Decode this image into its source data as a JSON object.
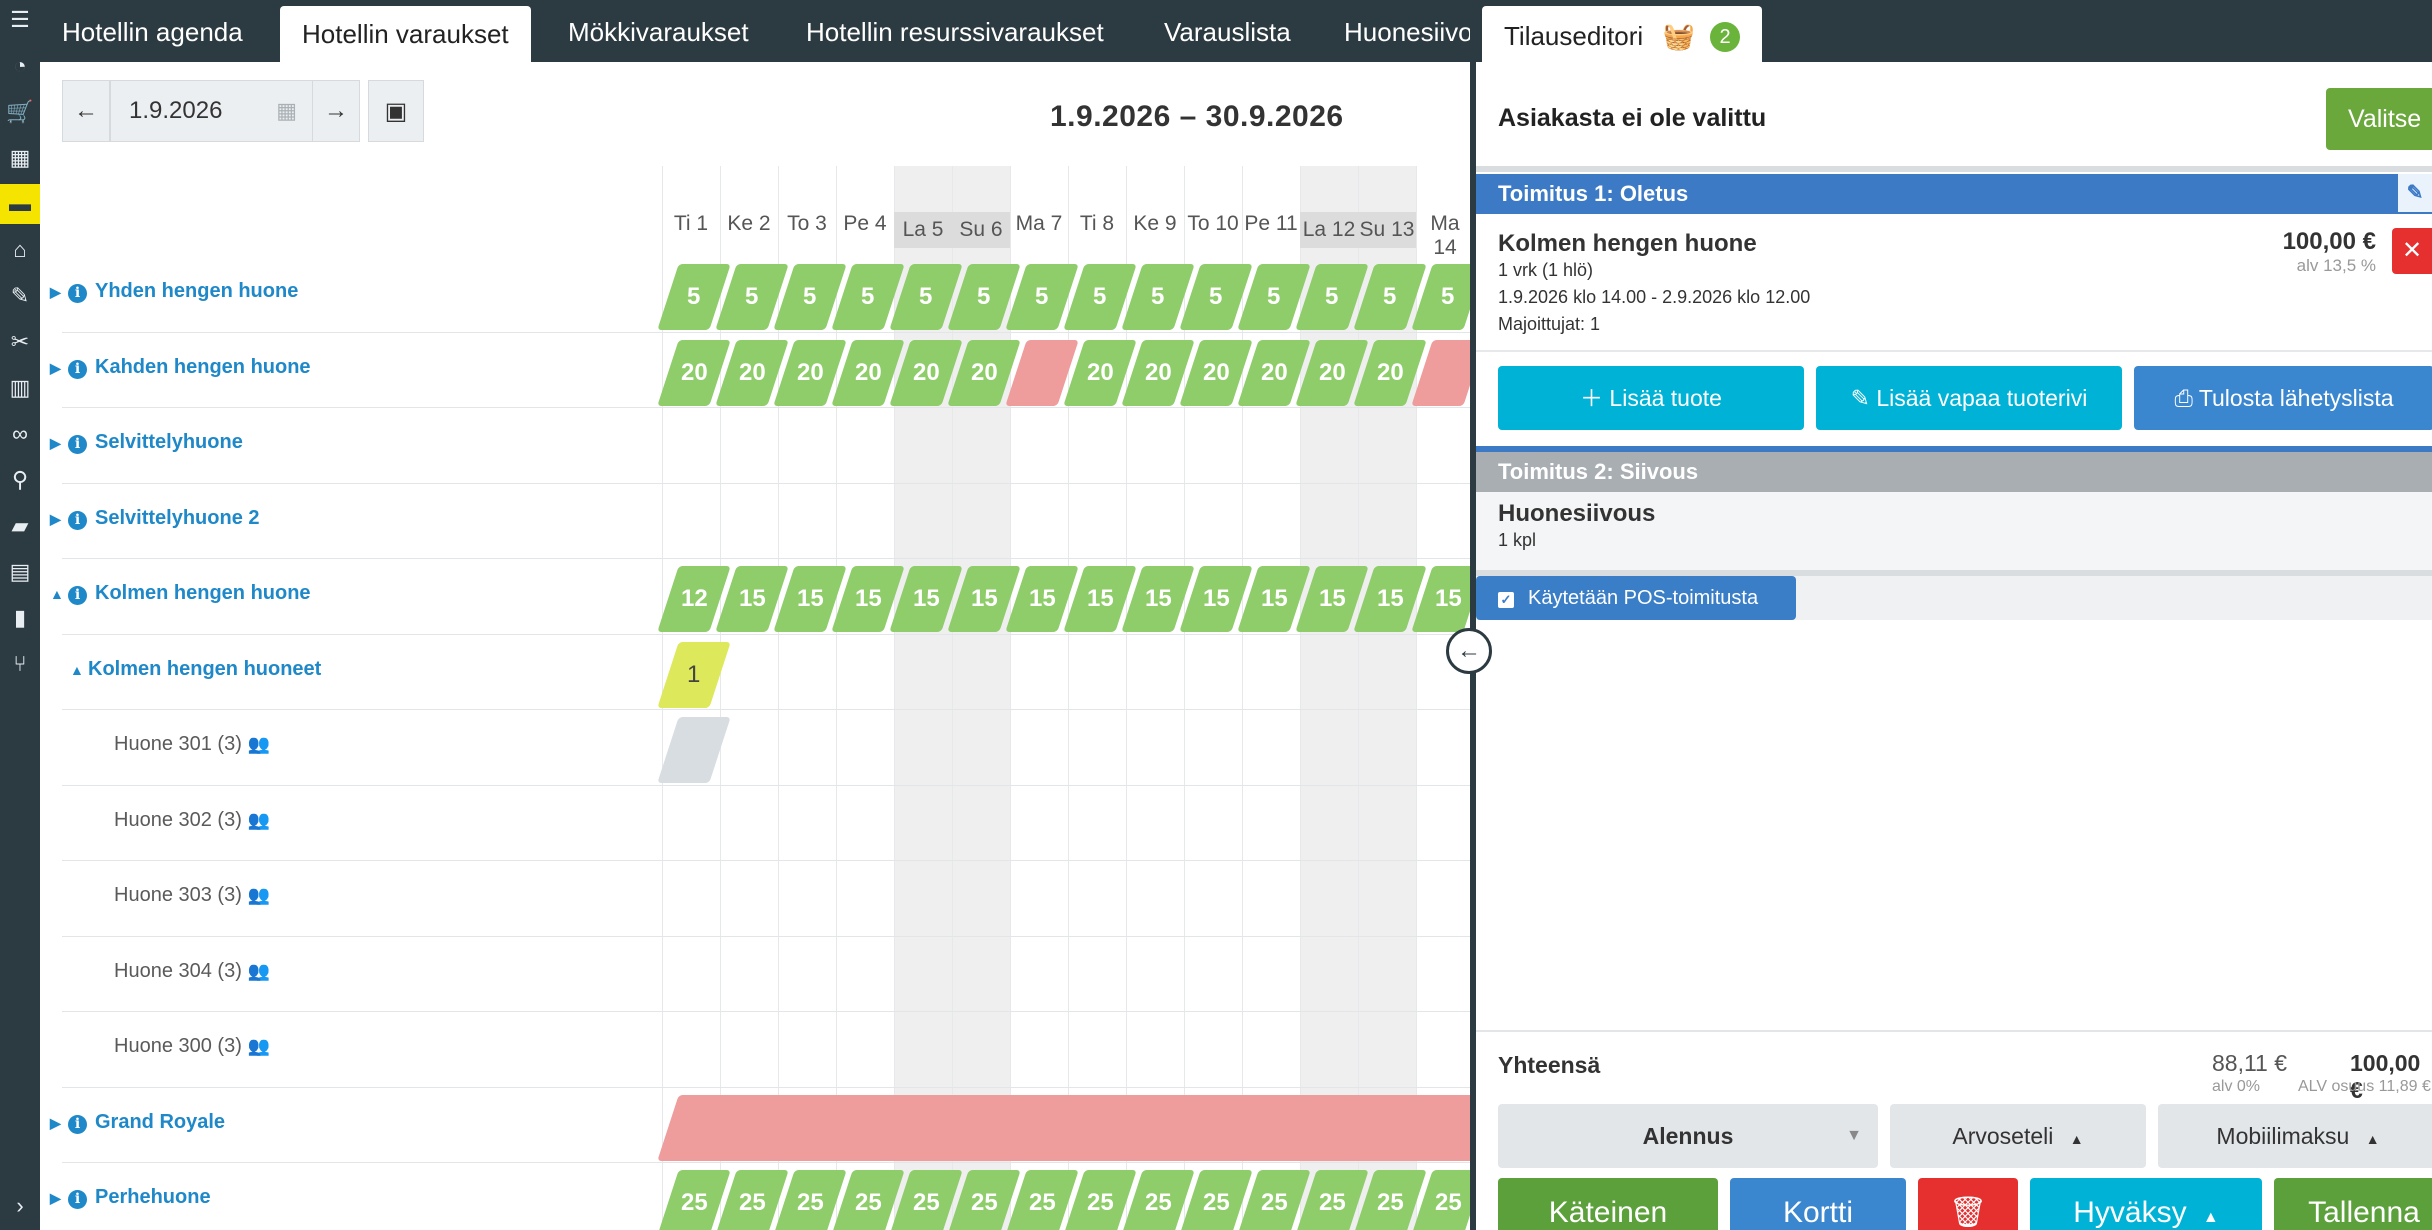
{
  "tabs": [
    {
      "label": "Hotellin agenda"
    },
    {
      "label": "Hotellin varaukset"
    },
    {
      "label": "Mökkivaraukset"
    },
    {
      "label": "Hotellin resurssivaraukset"
    },
    {
      "label": "Varauslista"
    },
    {
      "label": "Huonesiivo"
    }
  ],
  "date_controls": {
    "date_value": "1.9.2026"
  },
  "range_title": "1.9.2026 – 30.9.2026",
  "days": [
    "Ti 1",
    "Ke 2",
    "To 3",
    "Pe 4",
    "La 5",
    "Su 6",
    "Ma 7",
    "Ti 8",
    "Ke 9",
    "To 10",
    "Pe 11",
    "La 12",
    "Su 13",
    "Ma 14"
  ],
  "weekend_days": [
    4,
    5,
    11,
    12
  ],
  "rows": [
    {
      "label": "Yhden hengen huone",
      "type": "group",
      "expanded": false,
      "values": [
        "5",
        "5",
        "5",
        "5",
        "5",
        "5",
        "5",
        "5",
        "5",
        "5",
        "5",
        "5",
        "5",
        "5"
      ],
      "colors": [
        "g",
        "g",
        "g",
        "g",
        "g",
        "g",
        "g",
        "g",
        "g",
        "g",
        "g",
        "g",
        "g",
        "g"
      ]
    },
    {
      "label": "Kahden hengen huone",
      "type": "group",
      "expanded": false,
      "values": [
        "20",
        "20",
        "20",
        "20",
        "20",
        "20",
        "",
        "20",
        "20",
        "20",
        "20",
        "20",
        "20",
        ""
      ],
      "colors": [
        "g",
        "g",
        "g",
        "g",
        "g",
        "g",
        "r",
        "g",
        "g",
        "g",
        "g",
        "g",
        "g",
        "r"
      ]
    },
    {
      "label": "Selvittelyhuone",
      "type": "group",
      "expanded": false
    },
    {
      "label": "Selvittelyhuone 2",
      "type": "group",
      "expanded": false
    },
    {
      "label": "Kolmen hengen huone",
      "type": "group",
      "expanded": true,
      "values": [
        "12",
        "15",
        "15",
        "15",
        "15",
        "15",
        "15",
        "15",
        "15",
        "15",
        "15",
        "15",
        "15",
        "15"
      ],
      "colors": [
        "g",
        "g",
        "g",
        "g",
        "g",
        "g",
        "g",
        "g",
        "g",
        "g",
        "g",
        "g",
        "g",
        "g"
      ]
    },
    {
      "label": "Kolmen hengen huoneet",
      "type": "subgroup",
      "expanded": true,
      "values": [
        "1"
      ],
      "colors": [
        "y"
      ]
    },
    {
      "label": "Huone 301 (3)",
      "type": "room",
      "values": [
        ""
      ],
      "colors": [
        "gray"
      ]
    },
    {
      "label": "Huone 302 (3)",
      "type": "room"
    },
    {
      "label": "Huone 303 (3)",
      "type": "room"
    },
    {
      "label": "Huone 304 (3)",
      "type": "room"
    },
    {
      "label": "Huone 300 (3)",
      "type": "room"
    },
    {
      "label": "Grand Royale",
      "type": "group",
      "expanded": false,
      "fullbar": "r"
    },
    {
      "label": "Perhehuone",
      "type": "group",
      "expanded": false,
      "values": [
        "25",
        "25",
        "25",
        "25",
        "25",
        "25",
        "25",
        "25",
        "25",
        "25",
        "25",
        "25",
        "25",
        "25"
      ],
      "colors": [
        "g",
        "g",
        "g",
        "g",
        "g",
        "g",
        "g",
        "g",
        "g",
        "g",
        "g",
        "g",
        "g",
        "g"
      ]
    }
  ],
  "order_editor": {
    "tab_label": "Tilauseditori",
    "basket_count": "2",
    "no_customer": "Asiakasta ei ole valittu",
    "select_label": "Valitse",
    "delivery1": {
      "title": "Toimitus 1: Oletus",
      "item_name": "Kolmen hengen huone",
      "item_qty": "1 vrk (1 hlö)",
      "item_dates": "1.9.2026 klo 14.00 - 2.9.2026 klo 12.00",
      "item_guests": "Majoittujat: 1",
      "item_price": "100,00 €",
      "item_vat": "alv 13,5 %"
    },
    "actions": {
      "add_product": "Lisää tuote",
      "add_free_row": "Lisää vapaa tuoterivi",
      "print_list": "Tulosta lähetyslista"
    },
    "delivery2": {
      "title": "Toimitus 2: Siivous",
      "item_name": "Huonesiivous",
      "item_qty": "1 kpl"
    },
    "pos_label": "Käytetään POS-toimitusta",
    "totals": {
      "label": "Yhteensä",
      "net": "88,11 €",
      "net_vat": "alv 0%",
      "gross": "100,00 €",
      "gross_vat": "ALV osuus 11,89 €"
    },
    "options": {
      "discount": "Alennus",
      "voucher": "Arvoseteli",
      "mobilepay": "Mobiilimaksu"
    },
    "payments": {
      "cash": "Käteinen",
      "card": "Kortti",
      "approve": "Hyväksy",
      "save": "Tallenna"
    }
  },
  "colors": {
    "green": "#8fcc6a",
    "red": "#ee9c9c",
    "blue": "#3c7ac6",
    "cyan": "#00b3d6",
    "dark": "#2c3a42"
  }
}
